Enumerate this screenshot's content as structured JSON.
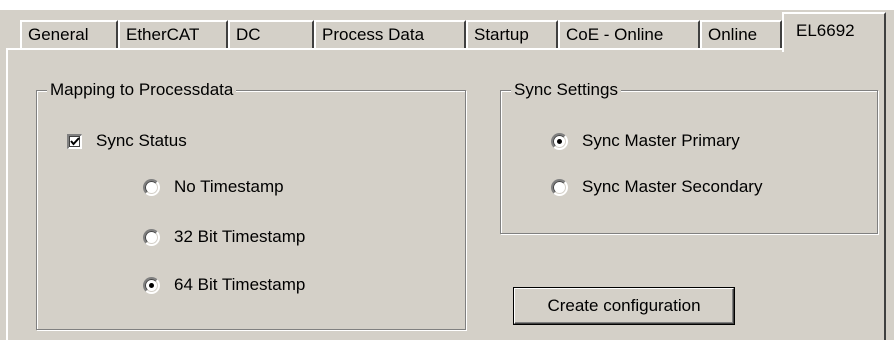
{
  "tabs": [
    {
      "label": "General",
      "active": false
    },
    {
      "label": "EtherCAT",
      "active": false
    },
    {
      "label": "DC",
      "active": false
    },
    {
      "label": "Process Data",
      "active": false
    },
    {
      "label": "Startup",
      "active": false
    },
    {
      "label": "CoE - Online",
      "active": false
    },
    {
      "label": "Online",
      "active": false
    },
    {
      "label": "EL6692",
      "active": true
    }
  ],
  "mapping": {
    "legend": "Mapping to Processdata",
    "sync_status": {
      "label": "Sync Status",
      "checked": true
    },
    "timestamps": [
      {
        "label": "No Timestamp",
        "selected": false
      },
      {
        "label": "32 Bit Timestamp",
        "selected": false
      },
      {
        "label": "64 Bit Timestamp",
        "selected": true
      }
    ]
  },
  "sync": {
    "legend": "Sync Settings",
    "options": [
      {
        "label": "Sync Master Primary",
        "selected": true
      },
      {
        "label": "Sync Master Secondary",
        "selected": false
      }
    ]
  },
  "create_button": {
    "label": "Create configuration"
  }
}
